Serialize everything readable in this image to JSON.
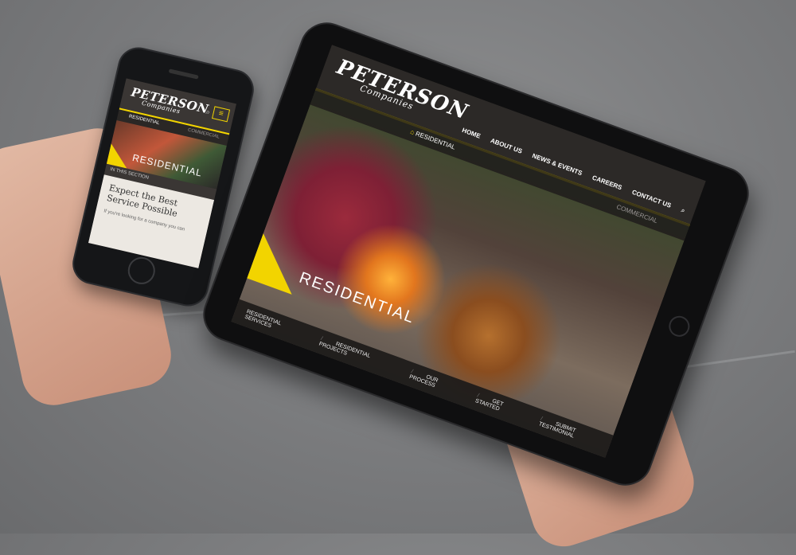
{
  "phone": {
    "logo": "PETERSON",
    "logo_sub": "Companies",
    "menu_icon": "≡",
    "search_icon": "⌕",
    "tab_residential": "RESIDENTIAL",
    "tab_commercial": "COMMERCIAL",
    "hero_title": "RESIDENTIAL",
    "section_label": "IN THIS SECTION",
    "heading": "Expect the Best Service Possible",
    "body_text": "If you're looking for a company you can"
  },
  "tablet": {
    "logo": "PETERSON",
    "logo_sub": "Companies",
    "nav": [
      "HOME",
      "ABOUT US",
      "NEWS & EVENTS",
      "CAREERS",
      "CONTACT US"
    ],
    "search_icon": "⌕",
    "tab_residential": "RESIDENTIAL",
    "tab_commercial": "COMMERCIAL",
    "hero_title": "RESIDENTIAL",
    "footer_links": [
      "RESIDENTIAL SERVICES",
      "RESIDENTIAL PROJECTS",
      "OUR PROCESS",
      "GET STARTED",
      "SUBMIT TESTIMONIAL"
    ]
  },
  "colors": {
    "accent": "#f2d400",
    "dark": "#2c2927"
  }
}
